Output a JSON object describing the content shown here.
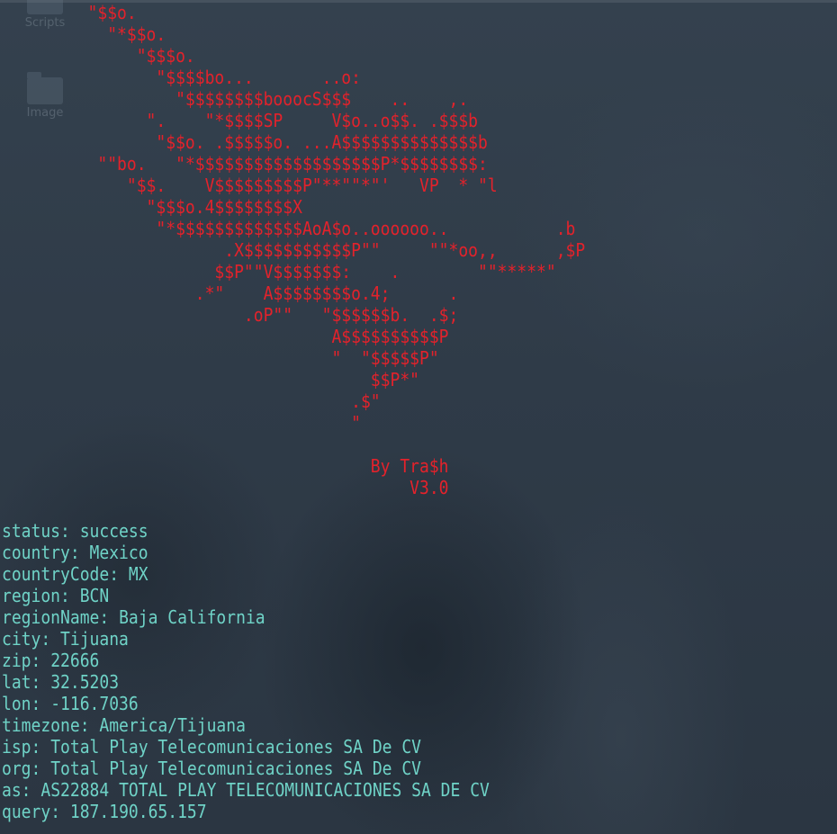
{
  "desktop": {
    "icons": [
      {
        "label": "Scripts",
        "icon": "folder-icon"
      },
      {
        "label": "Image",
        "icon": "folder-icon"
      }
    ]
  },
  "terminal": {
    "banner_lines": [
      "         \"$$o.",
      "           \"*$$o.",
      "              \"$$$o.",
      "                \"$$$$bo...       ..o:",
      "                  \"$$$$$$$$booocS$$$    ..    ,.",
      "               \".    \"*$$$$SP     V$o..o$$. .$$$b",
      "                \"$$o. .$$$$$o. ...A$$$$$$$$$$$$$$b",
      "          \"\"bo.   \"*$$$$$$$$$$$$$$$$$$$P*$$$$$$$$:",
      "             \"$$.    V$$$$$$$$$P\"**\"\"*\"'   VP  * \"l",
      "               \"$$$o.4$$$$$$$$X",
      "                \"*$$$$$$$$$$$$$AoA$o..oooooo..           .b",
      "                       .X$$$$$$$$$$$P\"\"     \"\"*oo,,      ,$P",
      "                      $$P\"\"V$$$$$$$:    .        \"\"*****\"",
      "                    .*\"    A$$$$$$$$o.4;      .",
      "                         .oP\"\"   \"$$$$$$b.  .$;",
      "                                  A$$$$$$$$$$P",
      "                                  \"  \"$$$$$P\"",
      "                                      $$P*\"",
      "                                    .$\"",
      "                                    \""
    ],
    "credit_author": "                                      By Tra$h",
    "credit_version": "                                          V3.0",
    "output": [
      {
        "key": "status",
        "value": "success"
      },
      {
        "key": "country",
        "value": "Mexico"
      },
      {
        "key": "countryCode",
        "value": "MX"
      },
      {
        "key": "region",
        "value": "BCN"
      },
      {
        "key": "regionName",
        "value": "Baja California"
      },
      {
        "key": "city",
        "value": "Tijuana"
      },
      {
        "key": "zip",
        "value": "22666"
      },
      {
        "key": "lat",
        "value": "32.5203"
      },
      {
        "key": "lon",
        "value": "-116.7036"
      },
      {
        "key": "timezone",
        "value": "America/Tijuana"
      },
      {
        "key": "isp",
        "value": "Total Play Telecomunicaciones SA De CV"
      },
      {
        "key": "org",
        "value": "Total Play Telecomunicaciones SA De CV"
      },
      {
        "key": "as",
        "value": "AS22884 TOTAL PLAY TELECOMUNICACIONES SA DE CV"
      },
      {
        "key": "query",
        "value": "187.190.65.157"
      }
    ]
  },
  "colors": {
    "banner": "#e3222b",
    "output": "#6fd3c7",
    "background": "#2e3a47"
  }
}
